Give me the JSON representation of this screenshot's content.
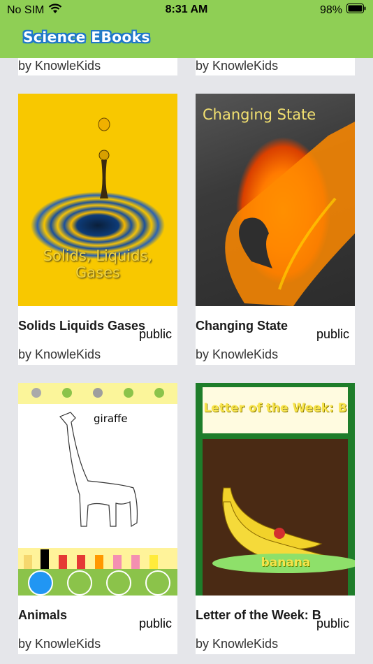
{
  "status_bar": {
    "carrier": "No SIM",
    "time": "8:31 AM",
    "battery": "98%"
  },
  "header": {
    "logo_text": "Science EBooks"
  },
  "books": [
    {
      "author": "by KnowleKids"
    },
    {
      "author": "by KnowleKids"
    },
    {
      "title": "Solids Liquids Gases",
      "visibility": "public",
      "author": "by KnowleKids",
      "cover_line1": "Solids, Liquids,",
      "cover_line2": "Gases"
    },
    {
      "title": "Changing State",
      "visibility": "public",
      "author": "by KnowleKids",
      "cover_title": "Changing State"
    },
    {
      "title": "Animals",
      "visibility": "public",
      "author": "by KnowleKids",
      "cover_caption": "giraffe"
    },
    {
      "title": "Letter of the Week: B",
      "visibility": "public",
      "author": "by KnowleKids",
      "cover_title": "Letter of the Week: B",
      "cover_caption": "banana"
    }
  ],
  "colors": {
    "header_green": "#8fcf55",
    "background": "#e5e6ea",
    "logo_outline": "#1f78c9"
  }
}
